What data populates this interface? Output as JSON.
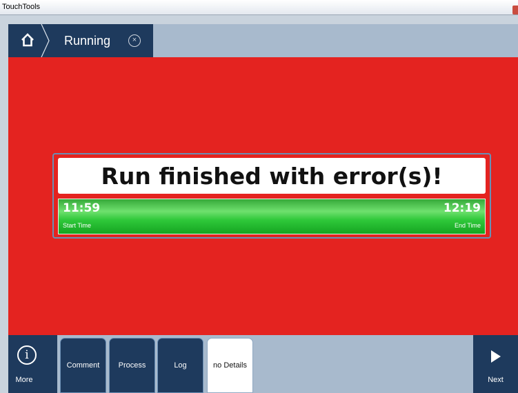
{
  "window": {
    "title": "TouchTools"
  },
  "nav": {
    "home_icon": "home-icon",
    "crumb_label": "Running",
    "crumb_close_icon": "close-circle-icon",
    "crumb_close_glyph": "×"
  },
  "status": {
    "message": "Run finished with error(s)!",
    "start_time": "11:59",
    "start_label": "Start Time",
    "end_time": "12:19",
    "end_label": "End Time"
  },
  "toolbar": {
    "more_label": "More",
    "more_icon": "info-icon",
    "info_glyph": "i",
    "comment_label": "Comment",
    "process_label": "Process",
    "log_label": "Log",
    "details_label": "no Details",
    "next_label": "Next",
    "next_icon": "play-icon"
  },
  "colors": {
    "status_error": "#e42320",
    "nav_dark": "#1e3a5d",
    "nav_light": "#a8bacd",
    "time_bar_green": "#2fc83a"
  }
}
